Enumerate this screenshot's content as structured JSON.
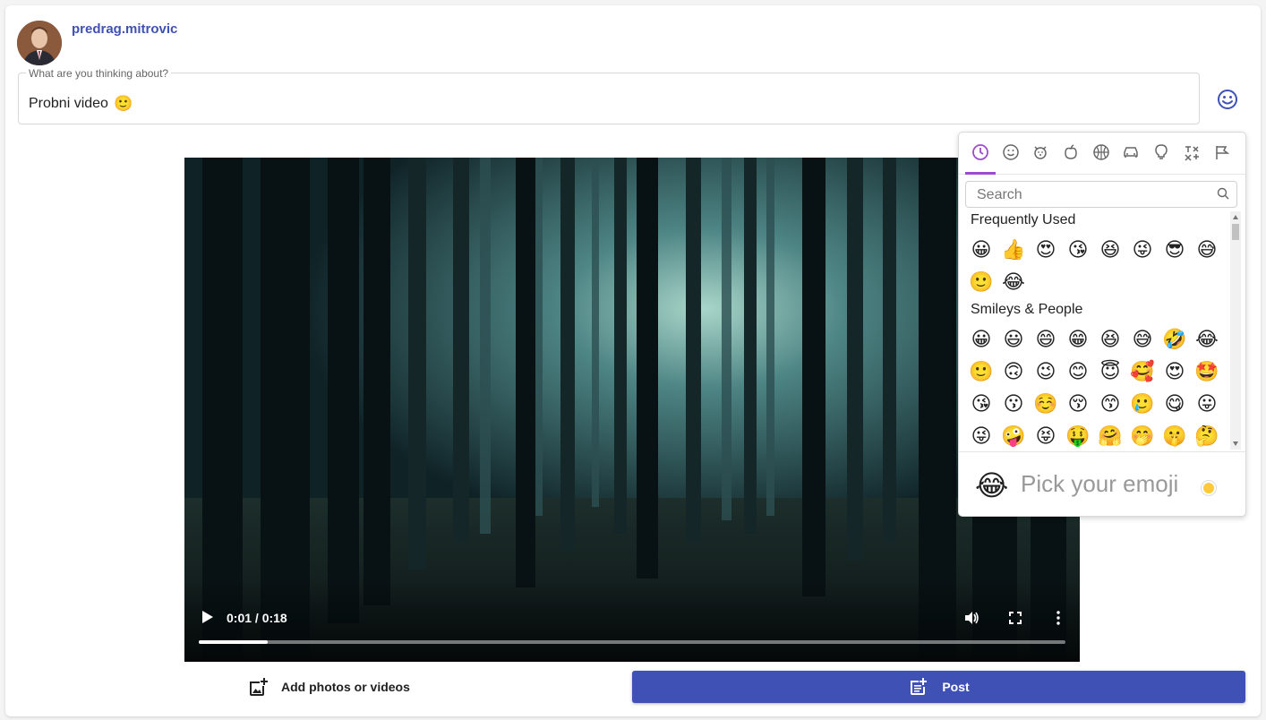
{
  "user": {
    "name": "predrag.mitrovic"
  },
  "composer": {
    "label": "What are you thinking about?",
    "value": "Probni video",
    "value_emoji": "🙂"
  },
  "video": {
    "time": "0:01 / 0:18",
    "progress": 0.08
  },
  "actions": {
    "add_media_label": "Add photos or videos",
    "post_label": "Post"
  },
  "colors": {
    "primary": "#3f51b5",
    "picker_accent": "#9c4dcc"
  },
  "emoji_picker": {
    "categories": [
      "clock-icon",
      "smiley-icon",
      "animal-icon",
      "food-icon",
      "ball-icon",
      "car-icon",
      "bulb-icon",
      "symbols-icon",
      "flag-icon"
    ],
    "search_placeholder": "Search",
    "frequently_used_title": "Frequently Used",
    "frequently_used": [
      "😀",
      "👍",
      "😍",
      "😘",
      "😆",
      "😜",
      "😎",
      "😅",
      "🙂",
      "😂"
    ],
    "smileys_title": "Smileys & People",
    "smileys": [
      "😀",
      "😃",
      "😄",
      "😁",
      "😆",
      "😅",
      "🤣",
      "😂",
      "🙂",
      "🙃",
      "😉",
      "😊",
      "😇",
      "🥰",
      "😍",
      "🤩",
      "😘",
      "😗",
      "☺️",
      "😚",
      "😙",
      "🥲",
      "😋",
      "😛",
      "😜",
      "🤪",
      "😝",
      "🤑",
      "🤗",
      "🤭",
      "🤫",
      "🤔"
    ],
    "preview_emoji": "😂",
    "preview_text": "Pick your emoji"
  }
}
